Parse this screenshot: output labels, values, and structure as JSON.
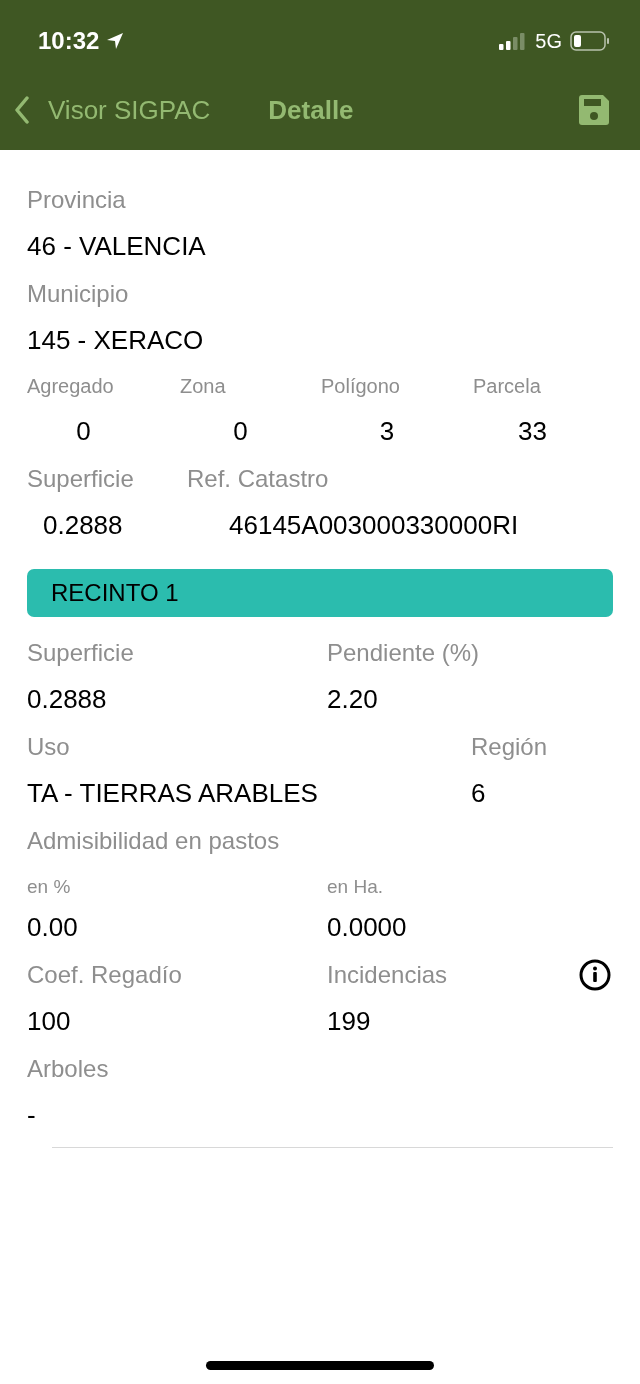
{
  "status_bar": {
    "time": "10:32",
    "network": "5G"
  },
  "nav": {
    "back_label": "Visor SIGPAC",
    "title": "Detalle"
  },
  "parcel": {
    "provincia": {
      "label": "Provincia",
      "value": "46 - VALENCIA"
    },
    "municipio": {
      "label": "Municipio",
      "value": "145 - XERACO"
    },
    "codes": [
      {
        "label": "Agregado",
        "value": "0"
      },
      {
        "label": "Zona",
        "value": "0"
      },
      {
        "label": "Polígono",
        "value": "3"
      },
      {
        "label": "Parcela",
        "value": "33"
      }
    ],
    "superficie": {
      "label": "Superficie",
      "value": "0.2888"
    },
    "ref_catastro": {
      "label": "Ref. Catastro",
      "value": "46145A003000330000RI"
    }
  },
  "recinto": {
    "title": "RECINTO 1",
    "superficie": {
      "label": "Superficie",
      "value": "0.2888"
    },
    "pendiente": {
      "label": "Pendiente (%)",
      "value": "2.20"
    },
    "uso": {
      "label": "Uso",
      "value": "TA - TIERRAS ARABLES"
    },
    "region": {
      "label": "Región",
      "value": "6"
    },
    "admisibilidad": {
      "label": "Admisibilidad en pastos",
      "percent": {
        "label": "en %",
        "value": "0.00"
      },
      "hectares": {
        "label": "en Ha.",
        "value": "0.0000"
      }
    },
    "coef_regadio": {
      "label": "Coef. Regadío",
      "value": "100"
    },
    "incidencias": {
      "label": "Incidencias",
      "value": "199"
    },
    "arboles": {
      "label": "Arboles",
      "value": "-"
    }
  }
}
